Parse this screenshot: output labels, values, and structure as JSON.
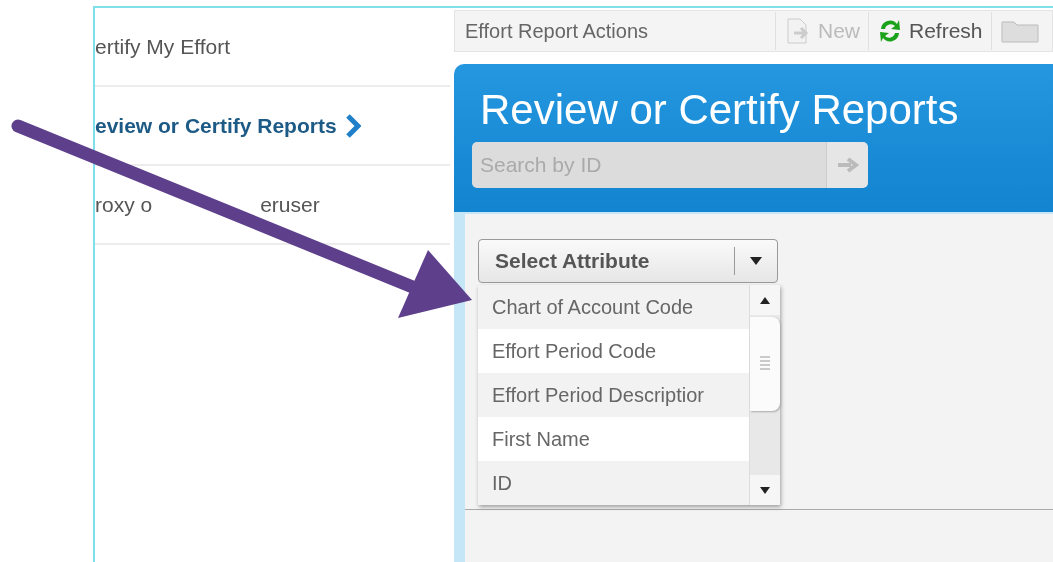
{
  "sidebar": {
    "items": [
      {
        "label": "ertify My Effort",
        "selected": false
      },
      {
        "label": "eview or Certify Reports",
        "selected": true
      },
      {
        "label": "roxy o",
        "label_after": "eruser",
        "selected": false
      }
    ]
  },
  "toolbar": {
    "title": "Effort Report Actions",
    "buttons": [
      {
        "kind": "new",
        "label": "New",
        "disabled": true
      },
      {
        "kind": "refresh",
        "label": "Refresh",
        "disabled": false
      },
      {
        "kind": "folder"
      }
    ]
  },
  "header": {
    "title": "Review or Certify Reports",
    "search": {
      "placeholder": "Search by ID"
    }
  },
  "attribute_select": {
    "label": "Select Attribute",
    "options": [
      "Chart of Account Code",
      "Effort Period Code",
      "Effort Period Descriptior",
      "First Name",
      "ID"
    ]
  }
}
